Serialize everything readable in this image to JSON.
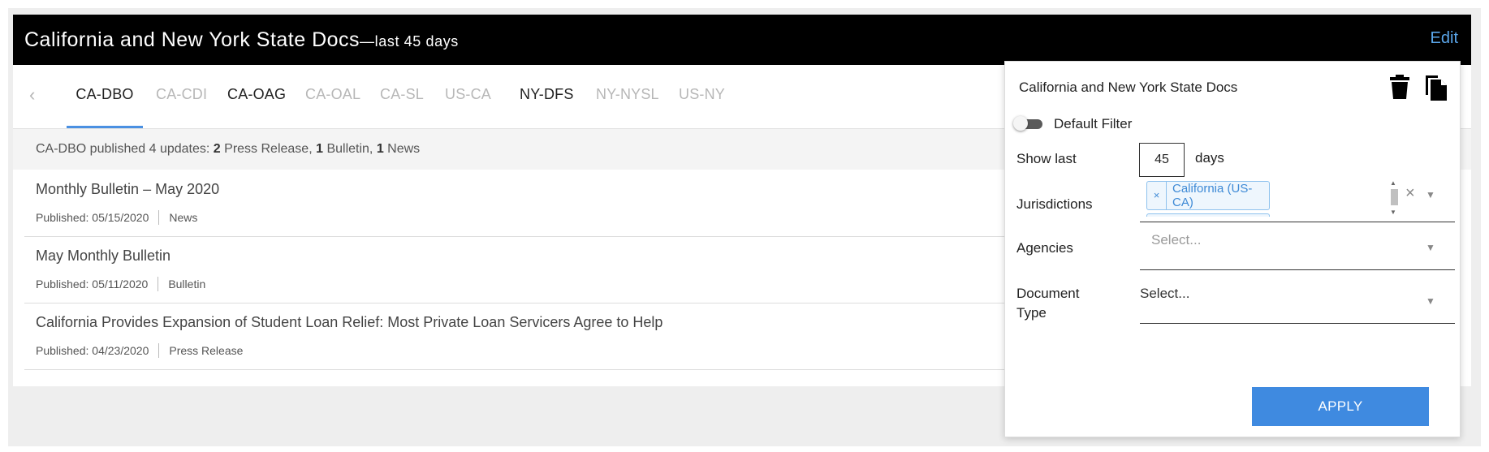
{
  "widget": {
    "title": "California and New York State Docs",
    "subtitle": "—last 45 days",
    "edit_label": "Edit"
  },
  "tabs": {
    "prev_glyph": "‹",
    "items": [
      {
        "label": "CA-DBO",
        "state": "active"
      },
      {
        "label": "CA-CDI",
        "state": "dim"
      },
      {
        "label": "CA-OAG",
        "state": "enabled"
      },
      {
        "label": "CA-OAL",
        "state": "dim"
      },
      {
        "label": "CA-SL",
        "state": "dim"
      },
      {
        "label": "US-CA",
        "state": "dim"
      },
      {
        "label": "NY-DFS",
        "state": "enabled"
      },
      {
        "label": "NY-NYSL",
        "state": "dim"
      },
      {
        "label": "US-NY",
        "state": "dim"
      }
    ]
  },
  "summary": {
    "prefix": "CA-DBO published 4 updates: ",
    "press_count": "2",
    "press_label": " Press Release, ",
    "bulletin_count": "1",
    "bulletin_label": " Bulletin, ",
    "news_count": "1",
    "news_label": " News"
  },
  "documents": [
    {
      "title": "Monthly Bulletin – May 2020",
      "published_label": "Published:",
      "date": "05/15/2020",
      "type": "News"
    },
    {
      "title": "May Monthly Bulletin",
      "published_label": "Published:",
      "date": "05/11/2020",
      "type": "Bulletin"
    },
    {
      "title": "California Provides Expansion of Student Loan Relief: Most Private Loan Servicers Agree to Help",
      "published_label": "Published:",
      "date": "04/23/2020",
      "type": "Press Release"
    }
  ],
  "filter_panel": {
    "title": "California and New York State Docs",
    "default_filter": {
      "label": "Default Filter",
      "enabled": false
    },
    "show_last": {
      "label": "Show last",
      "value": "45",
      "unit": "days"
    },
    "jurisdictions": {
      "label": "Jurisdictions",
      "chip_remove": "×",
      "selected": "California (US-CA)",
      "clear": "×"
    },
    "agencies": {
      "label": "Agencies",
      "placeholder": "Select..."
    },
    "document_type": {
      "label_line1": "Document",
      "label_line2": "Type",
      "placeholder": "Select..."
    },
    "apply_label": "APPLY",
    "icons": {
      "delete": "trash-icon",
      "copy": "copy-icon"
    }
  },
  "colors": {
    "header_bg": "#000000",
    "accent": "#4a90e2",
    "apply_bg": "#3f8ae0",
    "edit_link": "#5aa6ea",
    "chip_border": "#8ec2ee"
  }
}
